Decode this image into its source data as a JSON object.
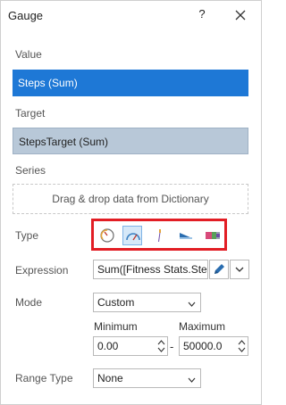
{
  "window": {
    "title": "Gauge",
    "help_label": "?"
  },
  "sections": {
    "value_label": "Value",
    "value_field": "Steps (Sum)",
    "target_label": "Target",
    "target_field": "StepsTarget (Sum)",
    "series_label": "Series",
    "series_drop_text": "Drag & drop data from Dictionary"
  },
  "type": {
    "label": "Type",
    "options": [
      {
        "name": "full-circular-gauge-icon",
        "selected": false
      },
      {
        "name": "half-circular-gauge-icon",
        "selected": true
      },
      {
        "name": "linear-gauge-icon",
        "selected": false
      },
      {
        "name": "bullet-gauge-icon",
        "selected": false
      },
      {
        "name": "horizontal-bar-gauge-icon",
        "selected": false
      }
    ]
  },
  "expression": {
    "label": "Expression",
    "value": "Sum([Fitness Stats.Steps])"
  },
  "mode": {
    "label": "Mode",
    "value": "Custom"
  },
  "range": {
    "minimum_label": "Minimum",
    "maximum_label": "Maximum",
    "minimum_value": "0.00",
    "maximum_value": "50000.0",
    "separator": "-"
  },
  "range_type": {
    "label": "Range Type",
    "value": "None"
  },
  "colors": {
    "accent": "#1e78d6",
    "highlight_border": "#e21d24",
    "target_bg": "#b8c8d8"
  }
}
